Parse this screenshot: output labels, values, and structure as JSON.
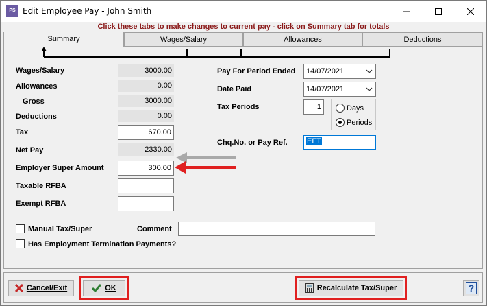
{
  "window": {
    "title": "Edit Employee Pay - John Smith",
    "app_icon_text": "PS"
  },
  "hint": "Click these tabs to make changes to current pay - click on Summary tab for totals",
  "tabs": [
    {
      "label": "Summary",
      "active": true
    },
    {
      "label": "Wages/Salary",
      "active": false
    },
    {
      "label": "Allowances",
      "active": false
    },
    {
      "label": "Deductions",
      "active": false
    }
  ],
  "left": {
    "wages_label": "Wages/Salary",
    "wages_value": "3000.00",
    "allowances_label": "Allowances",
    "allowances_value": "0.00",
    "gross_label": "Gross",
    "gross_value": "3000.00",
    "deductions_label": "Deductions",
    "deductions_value": "0.00",
    "tax_label": "Tax",
    "tax_value": "670.00",
    "netpay_label": "Net Pay",
    "netpay_value": "2330.00",
    "super_label": "Employer Super Amount",
    "super_value": "300.00",
    "taxable_rfba_label": "Taxable RFBA",
    "taxable_rfba_value": "",
    "exempt_rfba_label": "Exempt RFBA",
    "exempt_rfba_value": ""
  },
  "right": {
    "period_ended_label": "Pay For Period Ended",
    "period_ended_value": "14/07/2021",
    "date_paid_label": "Date Paid",
    "date_paid_value": "14/07/2021",
    "tax_periods_label": "Tax Periods",
    "tax_periods_value": "1",
    "radio_days": "Days",
    "radio_periods": "Periods",
    "selected_radio": "Periods",
    "ref_label": "Chq.No. or Pay Ref.",
    "ref_value": "EFT"
  },
  "bottom": {
    "manual_tax_label": "Manual Tax/Super",
    "comment_label": "Comment",
    "comment_value": "",
    "etp_label": "Has Employment Termination Payments?"
  },
  "buttons": {
    "cancel": "Cancel/Exit",
    "ok": "OK",
    "recalc": "Recalculate Tax/Super"
  },
  "colors": {
    "hint_text": "#8b1a1a",
    "annotation_red": "#e02020",
    "selection": "#0078d7"
  }
}
